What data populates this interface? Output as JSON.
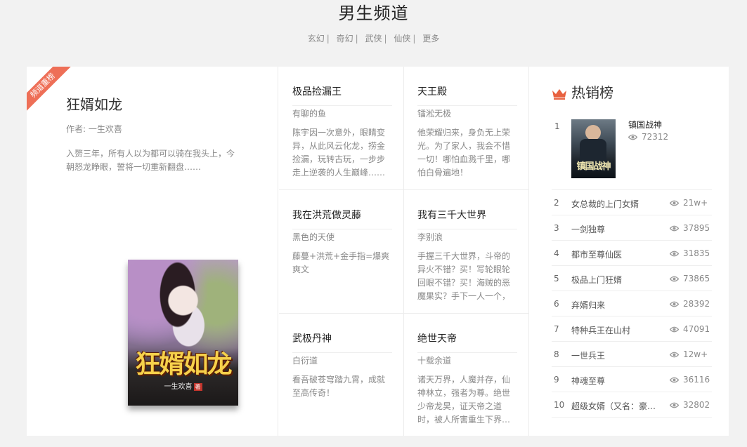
{
  "header": {
    "title": "男生频道",
    "nav": [
      "玄幻",
      "奇幻",
      "武侠",
      "仙侠",
      "更多"
    ],
    "separator": "|"
  },
  "featured": {
    "ribbon": "频道重榜",
    "title": "狂婿如龙",
    "author": "作者: 一生欢喜",
    "description": "入赘三年，所有人以为都可以骑在我头上，今朝怒龙睁眼，誓将一切重新翻盘……",
    "cover_title": "狂婿如龙",
    "cover_author": "一生欢喜",
    "cover_seal": "著"
  },
  "books": [
    {
      "title": "极品捡漏王",
      "author": "有聊的鱼",
      "desc": "陈宇因一次意外，眼睛变异，从此风云化龙，捞金捡漏，玩转古玩，一步步走上逆袭的人生巅峰……"
    },
    {
      "title": "天王殿",
      "author": "镭淞无极",
      "desc": "他荣耀归来，身负无上荣光。为了家人，我会不惜一切！哪怕血溅千里，哪怕白骨遍地！"
    },
    {
      "title": "我在洪荒做灵藤",
      "author": "黑色的天使",
      "desc": "藤蔓+洪荒+金手指=爆爽爽文"
    },
    {
      "title": "我有三千大世界",
      "author": "李别浪",
      "desc": "手握三千大世界，斗帝的异火不错？买！写轮眼轮回眼不错？买！海贼的恶魔果实？手下一人一个，"
    },
    {
      "title": "武极丹神",
      "author": "白衍道",
      "desc": "看吾破苍穹踏九霄，成就至高传奇！"
    },
    {
      "title": "绝世天帝",
      "author": "十载余道",
      "desc": "诸天万界，人魔并存，仙神林立，强者为尊。绝世少帝龙昊，证天帝之道时，被人所害重生下界…"
    }
  ],
  "ranking": {
    "title": "热销榜",
    "first": {
      "rank": "1",
      "name": "镇国战神",
      "views": "72312",
      "cover_text": "镇国战神"
    },
    "items": [
      {
        "rank": "2",
        "name": "女总裁的上门女婿",
        "views": "21w+"
      },
      {
        "rank": "3",
        "name": "一剑独尊",
        "views": "37895"
      },
      {
        "rank": "4",
        "name": "都市至尊仙医",
        "views": "31835"
      },
      {
        "rank": "5",
        "name": "极品上门狂婿",
        "views": "73865"
      },
      {
        "rank": "6",
        "name": "弃婿归来",
        "views": "28392"
      },
      {
        "rank": "7",
        "name": "特种兵王在山村",
        "views": "47091"
      },
      {
        "rank": "8",
        "name": "一世兵王",
        "views": "12w+"
      },
      {
        "rank": "9",
        "name": "神魂至尊",
        "views": "36116"
      },
      {
        "rank": "10",
        "name": "超级女婿（又名：豪门女婿）",
        "views": "32802"
      }
    ]
  },
  "colors": {
    "ribbon": "#ee6f57",
    "crown": "#e8613f",
    "eye": "#999999"
  }
}
